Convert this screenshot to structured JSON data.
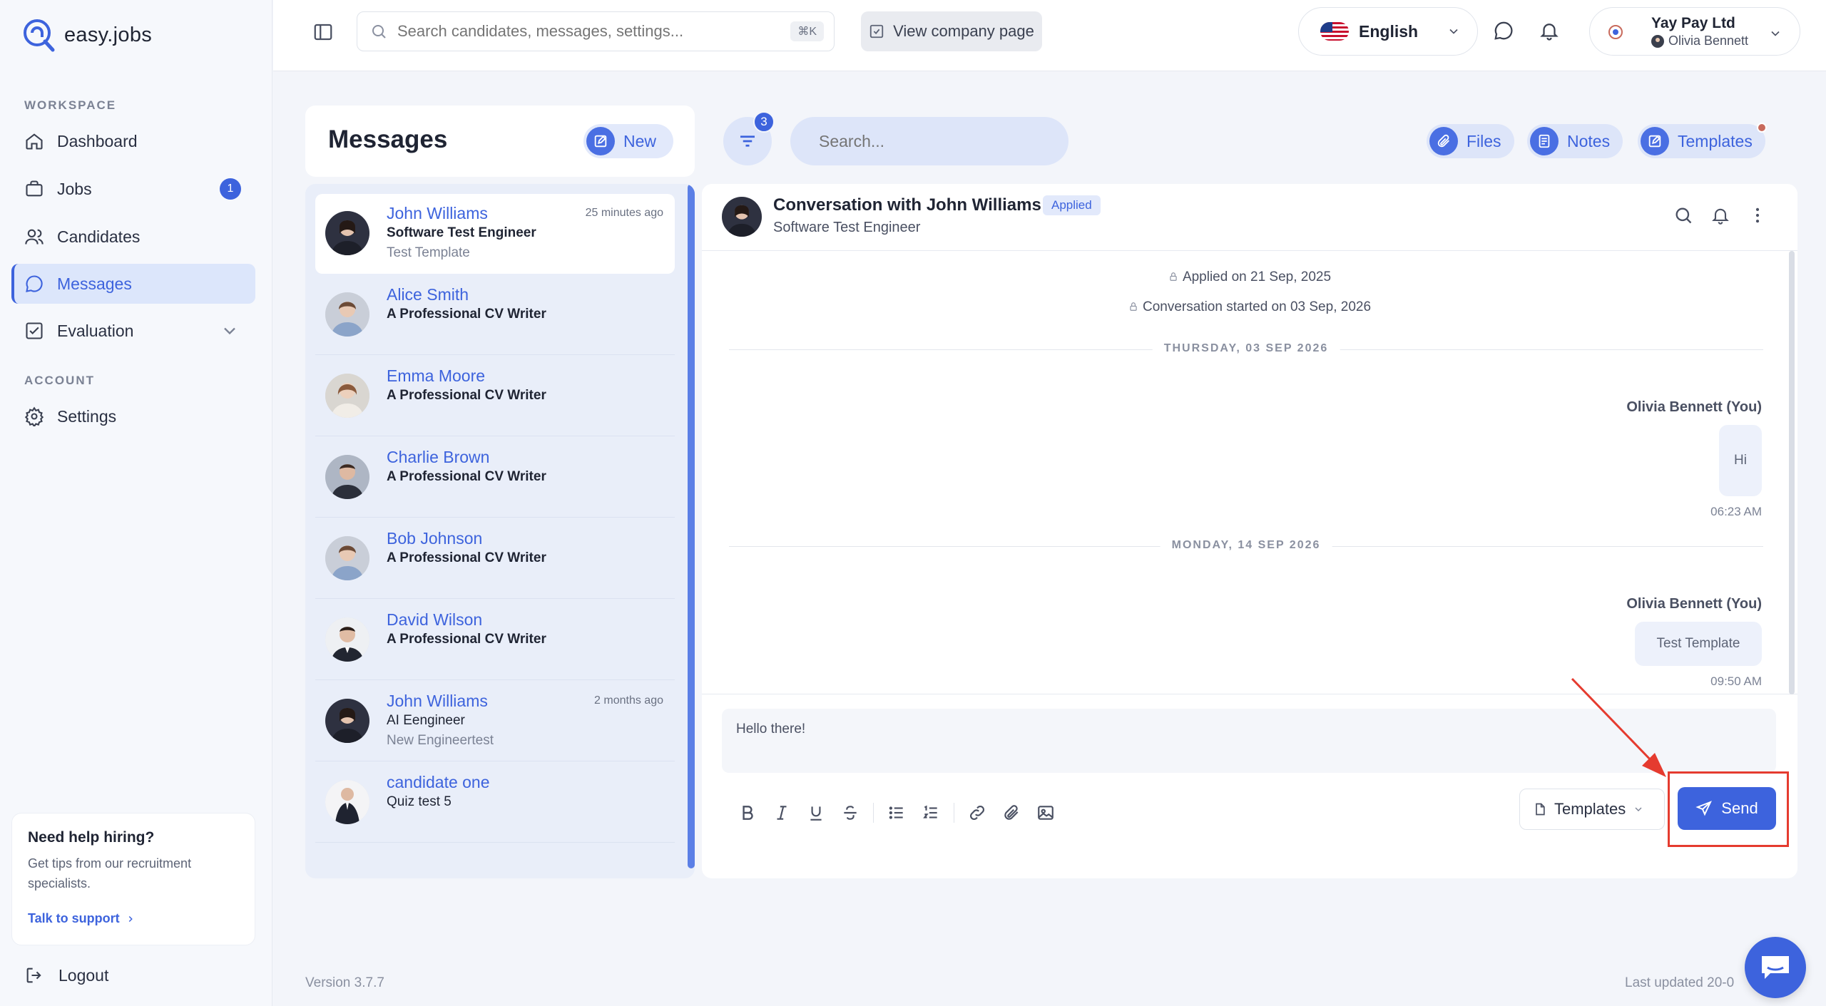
{
  "app": {
    "name": "easy.jobs"
  },
  "sidebar": {
    "workspace_label": "WORKSPACE",
    "account_label": "ACCOUNT",
    "items": [
      {
        "label": "Dashboard"
      },
      {
        "label": "Jobs",
        "badge": "1"
      },
      {
        "label": "Candidates"
      },
      {
        "label": "Messages",
        "active": true
      },
      {
        "label": "Evaluation"
      }
    ],
    "settings_label": "Settings",
    "help": {
      "title": "Need help hiring?",
      "text": "Get tips from our recruitment specialists.",
      "link": "Talk to support"
    },
    "logout": "Logout"
  },
  "topbar": {
    "search_placeholder": "Search candidates, messages, settings...",
    "shortcut": "⌘K",
    "company_page": "View company page",
    "language": "English",
    "company": "Yay Pay Ltd",
    "user": "Olivia Bennett"
  },
  "messages": {
    "title": "Messages",
    "new_label": "New",
    "filter_count": "3",
    "search_placeholder": "Search...",
    "files_label": "Files",
    "notes_label": "Notes",
    "templates_label": "Templates",
    "conversations": [
      {
        "name": "John Williams",
        "role": "Software Test Engineer",
        "last": "Test Template",
        "time": "25 minutes ago"
      },
      {
        "name": "Alice Smith",
        "role": "A Professional CV Writer"
      },
      {
        "name": "Emma Moore",
        "role": "A Professional CV Writer"
      },
      {
        "name": "Charlie Brown",
        "role": "A Professional CV Writer"
      },
      {
        "name": "Bob Johnson",
        "role": "A Professional CV Writer"
      },
      {
        "name": "David Wilson",
        "role": "A Professional CV Writer"
      },
      {
        "name": "John Williams",
        "role": "AI Eengineer",
        "last": "New Engineertest",
        "time": "2 months ago"
      },
      {
        "name": "candidate one",
        "role": "Quiz test 5"
      }
    ]
  },
  "conversation": {
    "title": "Conversation with John Williams",
    "status": "Applied",
    "subtitle": "Software Test Engineer",
    "applied_on": "Applied on 21 Sep, 2025",
    "started_on": "Conversation started on 03 Sep, 2026",
    "day1": "THURSDAY, 03 SEP 2026",
    "day2": "MONDAY, 14 SEP 2026",
    "msg1": {
      "sender": "Olivia Bennett (You)",
      "text": "Hi",
      "time": "06:23 AM"
    },
    "msg2": {
      "sender": "Olivia Bennett (You)",
      "text": "Test Template",
      "time": "09:50 AM"
    },
    "composer_text": "Hello there!",
    "templates_select": "Templates",
    "send_label": "Send"
  },
  "footer": {
    "version": "Version 3.7.7",
    "updated": "Last updated 20-0"
  },
  "colors": {
    "accent": "#3d63dd",
    "highlight": "#e53b2f"
  }
}
